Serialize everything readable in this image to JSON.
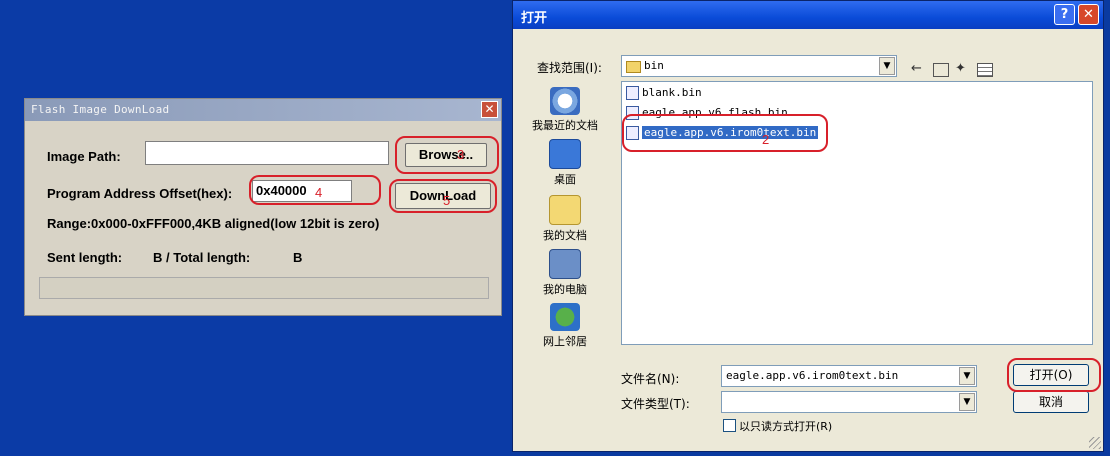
{
  "flash_dialog": {
    "title": "Flash Image DownLoad",
    "close_glyph": "✕",
    "image_path_label": "Image Path:",
    "image_path_value": "",
    "browse_label": "Browse..",
    "offset_label": "Program Address Offset(hex):",
    "offset_value": "0x40000",
    "download_label": "DownLoad",
    "range_text": "Range:0x000-0xFFF000,4KB aligned(low 12bit is zero)",
    "sent_length_label": "Sent length:",
    "total_length_text": "B / Total length:",
    "total_unit": "B",
    "progress": 0
  },
  "annotations": {
    "step_browse": "3",
    "step_offset": "4",
    "step_download": "5",
    "step_file": "2",
    "color": "#d8202a"
  },
  "open_dialog": {
    "title": "打开",
    "help_glyph": "?",
    "close_glyph": "✕",
    "look_in_label": "查找范围(I):",
    "look_in_value": "bin",
    "places": [
      "我最近的文档",
      "桌面",
      "我的文档",
      "我的电脑",
      "网上邻居"
    ],
    "files": [
      "blank.bin",
      "eagle.app.v6.flash.bin",
      "eagle.app.v6.irom0text.bin"
    ],
    "selected_index": 2,
    "filename_label": "文件名(N):",
    "filename_value": "eagle.app.v6.irom0text.bin",
    "filetype_label": "文件类型(T):",
    "filetype_value": "",
    "readonly_label": "以只读方式打开(R)",
    "open_button": "打开(O)",
    "cancel_button": "取消"
  },
  "colors": {
    "desktop": "#0a3aa0",
    "xp_titlebar": "#0a4bd8",
    "selection": "#316ac5"
  }
}
